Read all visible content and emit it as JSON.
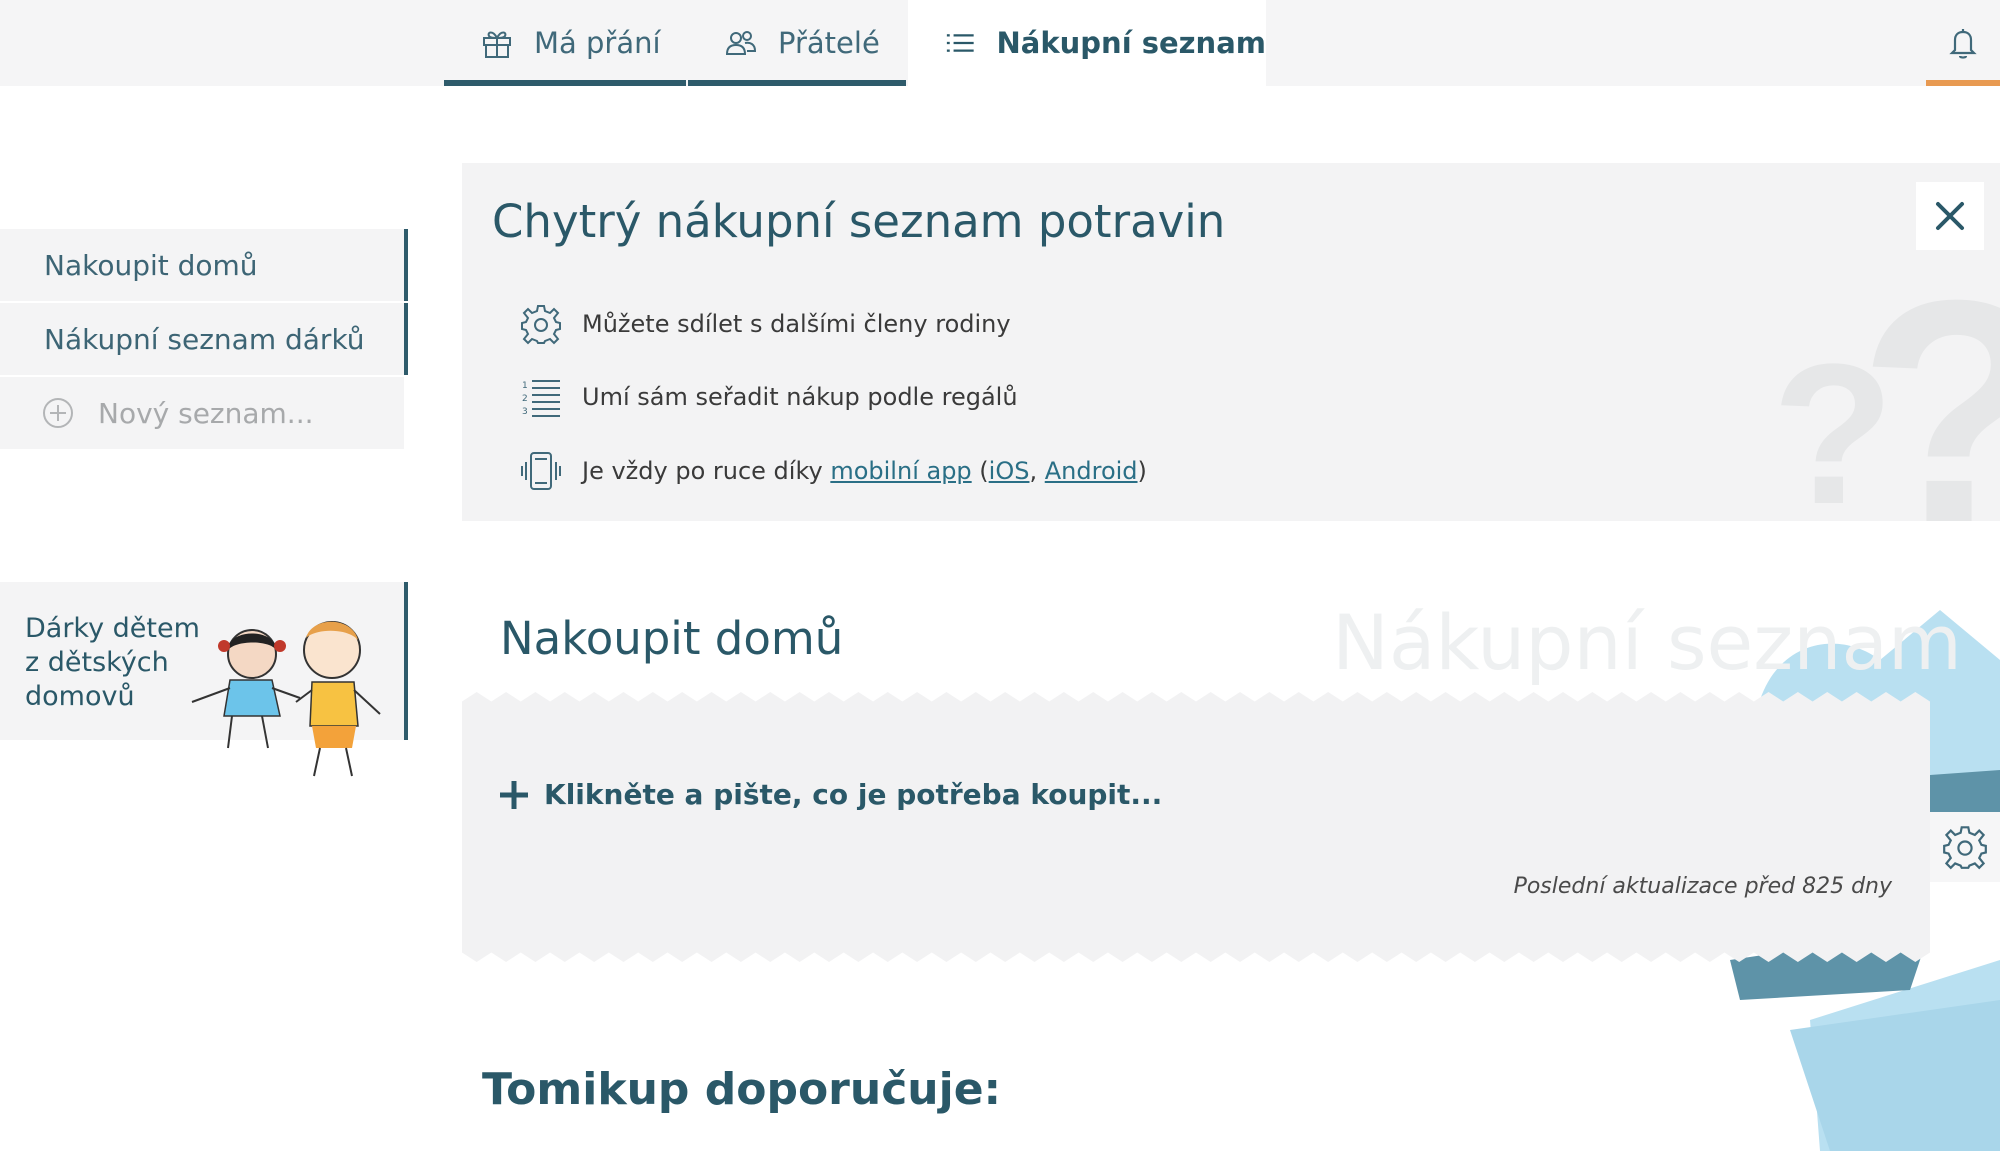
{
  "nav": {
    "tabs": [
      {
        "label": "Má přání",
        "icon": "gift-icon"
      },
      {
        "label": "Přátelé",
        "icon": "friends-icon"
      },
      {
        "label": "Nákupní seznam",
        "icon": "list-icon",
        "active": true
      }
    ],
    "notifications_icon": "bell-icon"
  },
  "sidebar": {
    "lists": [
      {
        "label": "Nakoupit domů"
      },
      {
        "label": "Nákupní seznam dárků"
      }
    ],
    "new_list_label": "Nový seznam...",
    "promo_text": "Dárky dětem\nz dětských\ndomovů"
  },
  "info": {
    "title": "Chytrý nákupní seznam potravin",
    "features": [
      {
        "icon": "gear-icon",
        "text": "Můžete sdílet s dalšími členy rodiny"
      },
      {
        "icon": "numbered-list-icon",
        "text": "Umí sám seřadit nákup podle regálů"
      },
      {
        "icon": "phone-icon",
        "text_before": "Je vždy po ruce díky ",
        "link_app": "mobilní app",
        "open_paren": " (",
        "link_ios": "iOS",
        "comma": ", ",
        "link_android": "Android",
        "close_paren": ")"
      }
    ]
  },
  "list": {
    "title": "Nakoupit domů",
    "watermark": "Nákupní seznam",
    "add_placeholder": "Klikněte a pište, co je potřeba koupit...",
    "last_updated": "Poslední aktualizace před 825 dny"
  },
  "recommend_title": "Tomikup doporučuje:",
  "colors": {
    "primary": "#2e5b6b",
    "accent": "#e89a52",
    "panel_bg": "#f3f3f4",
    "deco_blue": "#a9d6ea"
  }
}
